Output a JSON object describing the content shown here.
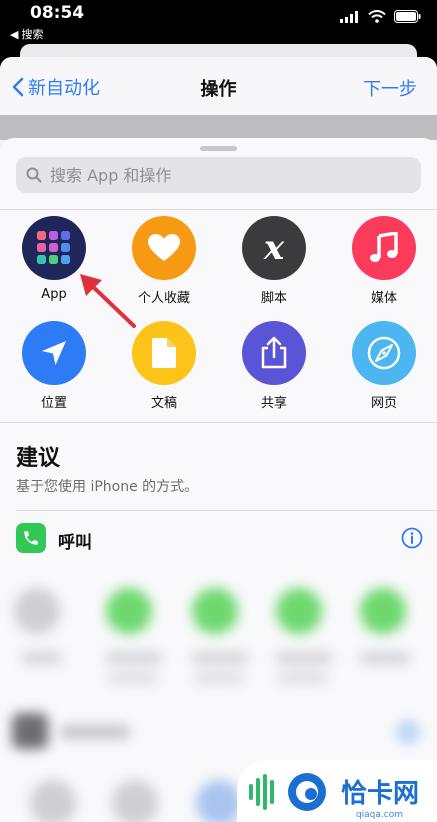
{
  "status": {
    "time": "08:54",
    "back_app": "搜索"
  },
  "nav": {
    "back_label": "新自动化",
    "title": "操作",
    "next_label": "下一步"
  },
  "search": {
    "placeholder": "搜索 App 和操作"
  },
  "categories": [
    {
      "label": "App",
      "icon": "app-grid-icon",
      "color": "#20265a"
    },
    {
      "label": "个人收藏",
      "icon": "heart-icon",
      "color": "#f59a12"
    },
    {
      "label": "脚本",
      "icon": "script-x-icon",
      "color": "#3b3b3d"
    },
    {
      "label": "媒体",
      "icon": "music-note-icon",
      "color": "#fb3b5c"
    },
    {
      "label": "位置",
      "icon": "location-arrow-icon",
      "color": "#2d7cf6"
    },
    {
      "label": "文稿",
      "icon": "document-icon",
      "color": "#fcc419"
    },
    {
      "label": "共享",
      "icon": "share-icon",
      "color": "#5a54d6"
    },
    {
      "label": "网页",
      "icon": "compass-icon",
      "color": "#4cb6f0"
    }
  ],
  "suggestions": {
    "title": "建议",
    "subtitle": "基于您使用 iPhone 的方式。",
    "first_item": {
      "label": "呼叫",
      "icon": "phone-icon",
      "color": "#33c758"
    }
  },
  "watermark": {
    "text": "恰卡网",
    "url": "qiaqa.com"
  },
  "colors": {
    "accent": "#2f7bf6",
    "annotation_arrow": "#e0313a"
  }
}
